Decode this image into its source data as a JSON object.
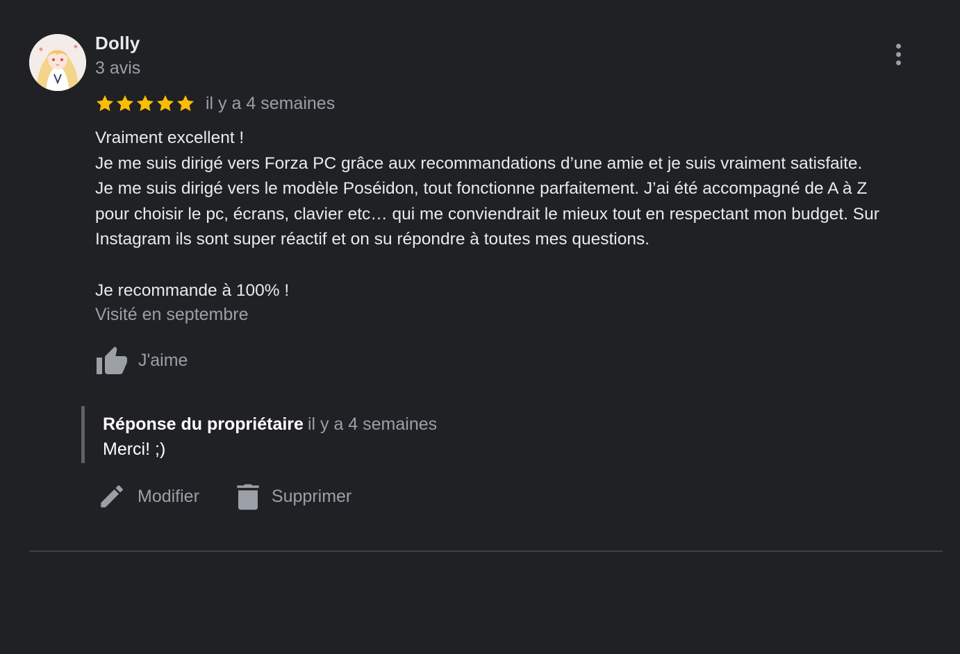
{
  "review": {
    "author_name": "Dolly",
    "author_meta": "3 avis",
    "rating": 5,
    "star_color": "#fbbc04",
    "date": "il y a 4 semaines",
    "text_lines": [
      "Vraiment excellent !",
      "Je me suis dirigé vers Forza PC grâce aux recommandations d’une amie et je suis vraiment satisfaite.",
      "Je me suis dirigé vers le modèle Poséidon, tout fonctionne parfaitement. J’ai été accompagné de A à Z",
      "pour choisir le pc, écrans, clavier etc… qui me conviendrait le mieux tout en respectant mon budget. Sur",
      "Instagram ils sont super réactif et on su répondre à toutes mes questions.",
      "",
      "Je recommande à 100% !"
    ],
    "visited": "Visité en septembre",
    "like_label": "J'aime"
  },
  "owner_reply": {
    "title": "Réponse du propriétaire",
    "date": "il y a 4 semaines",
    "text": "Merci! ;)"
  },
  "actions": {
    "edit_label": "Modifier",
    "delete_label": "Supprimer"
  },
  "icons": {
    "more": "more-vert-icon",
    "star": "star-icon",
    "like": "thumb-up-icon",
    "edit": "pencil-icon",
    "delete": "trash-icon"
  },
  "colors": {
    "background": "#202124",
    "primary_text": "#e8eaed",
    "secondary_text": "#9aa0a6",
    "reply_border": "#5f6368"
  }
}
